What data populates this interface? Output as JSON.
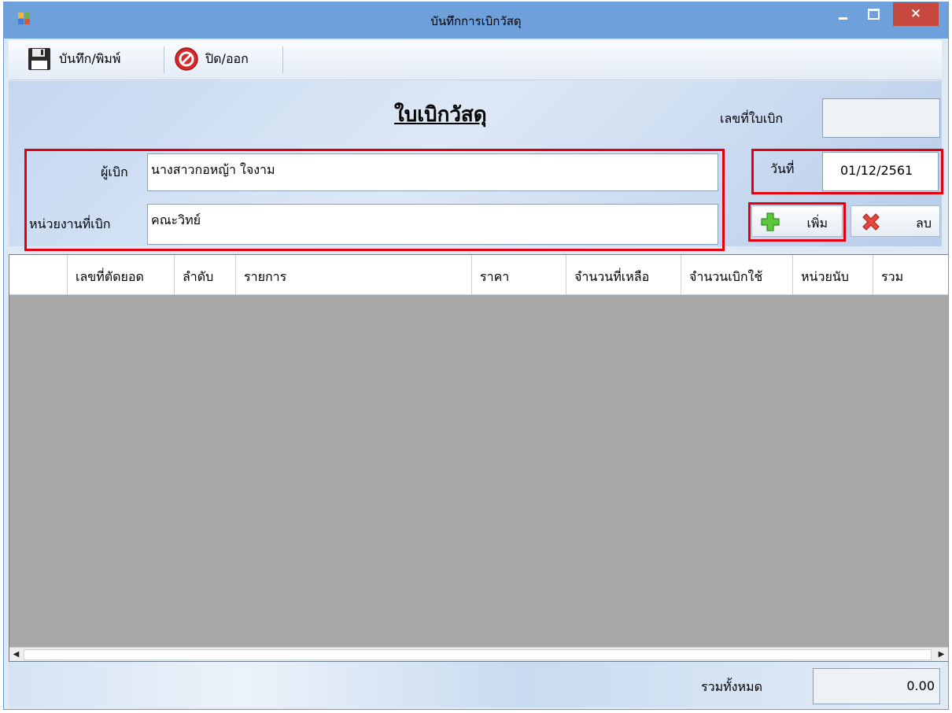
{
  "window": {
    "title": "บันทึกการเบิกวัสดุ",
    "close_glyph": "×"
  },
  "toolbar": {
    "save_label": "บันทึก/พิมพ์",
    "close_label": "ปิด/ออก"
  },
  "form": {
    "heading": "ใบเบิกวัสดุ",
    "doc_no_label": "เลขที่ใบเบิก",
    "doc_no_value": "",
    "requester_label": "ผู้เบิก",
    "requester_value": "นางสาวกอหญ้า ใจงาม",
    "department_label": "หน่วยงานที่เบิก",
    "department_value": "คณะวิทย์",
    "date_label": "วันที่",
    "date_value": "01/12/2561",
    "add_label": "เพิ่ม",
    "delete_label": "ลบ"
  },
  "grid": {
    "columns": [
      "เลขที่ตัดยอด",
      "ลำดับ",
      "รายการ",
      "ราคา",
      "จำนวนที่เหลือ",
      "จำนวนเบิกใช้",
      "หน่วยนับ",
      "รวม"
    ],
    "rows": []
  },
  "footer": {
    "total_label": "รวมทั้งหมด",
    "total_value": "0.00"
  },
  "colors": {
    "highlight": "#e0000f",
    "titlebar": "#6ea0dc",
    "close_button": "#c7483e",
    "grid_background": "#a8a8a8"
  },
  "icons": {
    "save": "floppy-disk-icon",
    "close": "no-entry-icon",
    "add": "green-plus-icon",
    "delete": "red-x-icon"
  }
}
